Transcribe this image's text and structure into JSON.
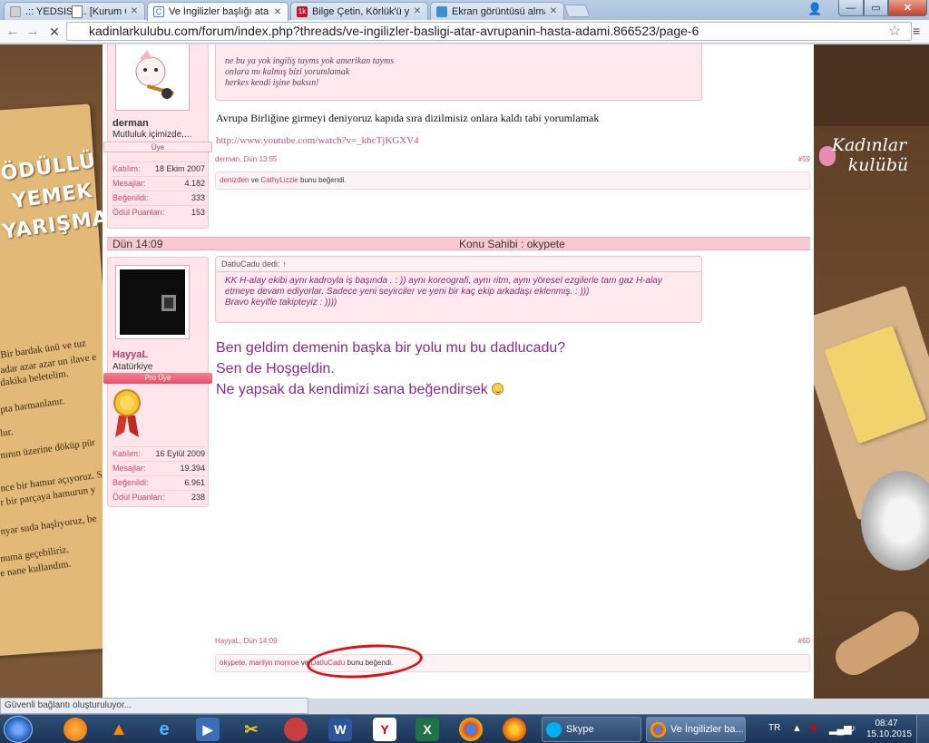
{
  "browser": {
    "tabs": [
      {
        "label": ".:: YEDSIS ::.. [Kurum Gele",
        "color": "#d0d0d0"
      },
      {
        "label": "Ve İngilizler başlığı atar; A",
        "color": "#3b7de0"
      },
      {
        "label": "Bilge Çetin, Körlük'ü yoru",
        "color": "#c8102e"
      },
      {
        "label": "Ekran görüntüsü alma",
        "color": "#3a8fd8"
      }
    ],
    "url": "kadinlarkulubu.com/forum/index.php?threads/ve-ingilizler-basligi-atar-avrupanin-hasta-adami.866523/page-6",
    "back_icon": "back-arrow-icon",
    "forward_icon": "forward-arrow-icon",
    "stop_icon": "stop-icon",
    "status": "Güvenli bağlantı oluşturuluyor..."
  },
  "promo": {
    "title": "ÖDÜLLÜ\nYEMEK\nYARIŞMASI",
    "recipe_lines": [
      "Bir bardak ünü ve tuz",
      "adar azar azar un ilave e",
      "dakika beletelim.",
      "pta harmanlanır.",
      "lur.",
      "nının üzerine döküp pür",
      "nce bir hamur açıyoruz. S",
      "r bir parçaya hamurun y",
      "nyar suda haşlıyoruz, be",
      "numa geçebiliriz.",
      "e nane kullandım."
    ]
  },
  "site_logo": {
    "line1": "Kadınlar",
    "line2": "kulübü"
  },
  "post1": {
    "user": {
      "name": "derman",
      "title": "Mutluluk içimizde....",
      "rank": "Üye",
      "stats": [
        {
          "key": "Katılım:",
          "value": "18 Ekim 2007"
        },
        {
          "key": "Mesajlar:",
          "value": "4.182"
        },
        {
          "key": "Beğenildi:",
          "value": "333"
        },
        {
          "key": "Ödül Puanları:",
          "value": "153"
        }
      ]
    },
    "quote_lines": [
      "ne bu ya yok ingiliş tayms yok amerikan tayms",
      "onlara mı kalmış bizi yorumlamak",
      "herkes kendi işine baksın!"
    ],
    "message": "Avrupa Birliğine girmeyi deniyoruz kapıda sıra dizilmisiz onlara kaldı tabi yorumlamak",
    "link": "http://www.youtube.com/watch?v=_khcTjKGXV4",
    "meta": "derman, Dün 13:55",
    "number": "#59",
    "likes": {
      "user1": "denizden",
      "joiner": "ve",
      "user2": "CathyLizzie",
      "suffix": "bunu beğendi."
    }
  },
  "post2": {
    "header_date": "Dün 14:09",
    "thread_starter": "Konu Sahibi : okypete",
    "user": {
      "name": "HayyaL",
      "title": "Atatürkiye",
      "rank": "Pro Üye",
      "stats": [
        {
          "key": "Katılım:",
          "value": "16 Eylül 2009"
        },
        {
          "key": "Mesajlar:",
          "value": "19.394"
        },
        {
          "key": "Beğenildi:",
          "value": "6.961"
        },
        {
          "key": "Ödül Puanları:",
          "value": "238"
        }
      ]
    },
    "quote_author": "DatluCadu dedi: ↑",
    "quote_lines": [
      "KK H-alay ekibi aynı kadroyla iş başında . : )) aynı koreografi, aynı ritm, aynı yöresel ezgilerle tam gaz H-alay",
      "etmeye devam ediyorlar. Sadece yeni seyirciler ve yeni bir kaç ekip arkadaşı eklenmiş. : )))",
      "Bravo keyifle takipteyiz : ))))"
    ],
    "message_lines": [
      "Ben geldim demenin başka bir yolu mu bu dadlucadu?",
      "Sen de Hoşgeldin.",
      "Ne yapsak da kendimizi sana beğendirsek"
    ],
    "meta": "HayyaL, Dün 14:09",
    "number": "#60",
    "likes": {
      "users": "okypete, marilyn monroe",
      "joiner": "ve",
      "user3": "DatluCadu",
      "suffix": "bunu beğendi."
    }
  },
  "taskbar": {
    "tasks": [
      {
        "label": "Skype",
        "color": "#00aff0"
      },
      {
        "label": "Ve İngilizler ba...",
        "color": "#db4437"
      }
    ],
    "language": "TR",
    "time": "08:47",
    "date": "15.10.2015"
  }
}
